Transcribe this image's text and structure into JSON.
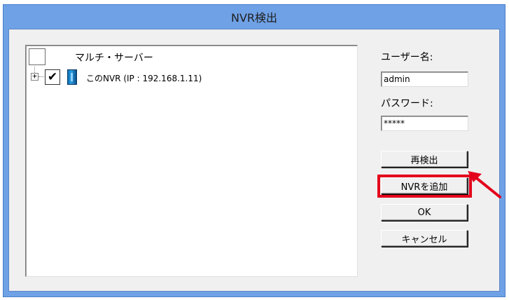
{
  "window": {
    "title": "NVR検出"
  },
  "tree": {
    "root_label": "マルチ・サーバー",
    "expander": "+",
    "check_mark": "✔",
    "node_label": "このNVR (IP : 192.168.1.11)"
  },
  "form": {
    "username_label": "ユーザー名:",
    "username_value": "admin",
    "password_label": "パスワード:",
    "password_value": "*****"
  },
  "buttons": {
    "rediscover": "再検出",
    "add_nvr": "NVRを追加",
    "ok": "OK",
    "cancel": "キャンセル"
  },
  "colors": {
    "title_bar": "#6fa1e6",
    "highlight": "#e3001b"
  }
}
